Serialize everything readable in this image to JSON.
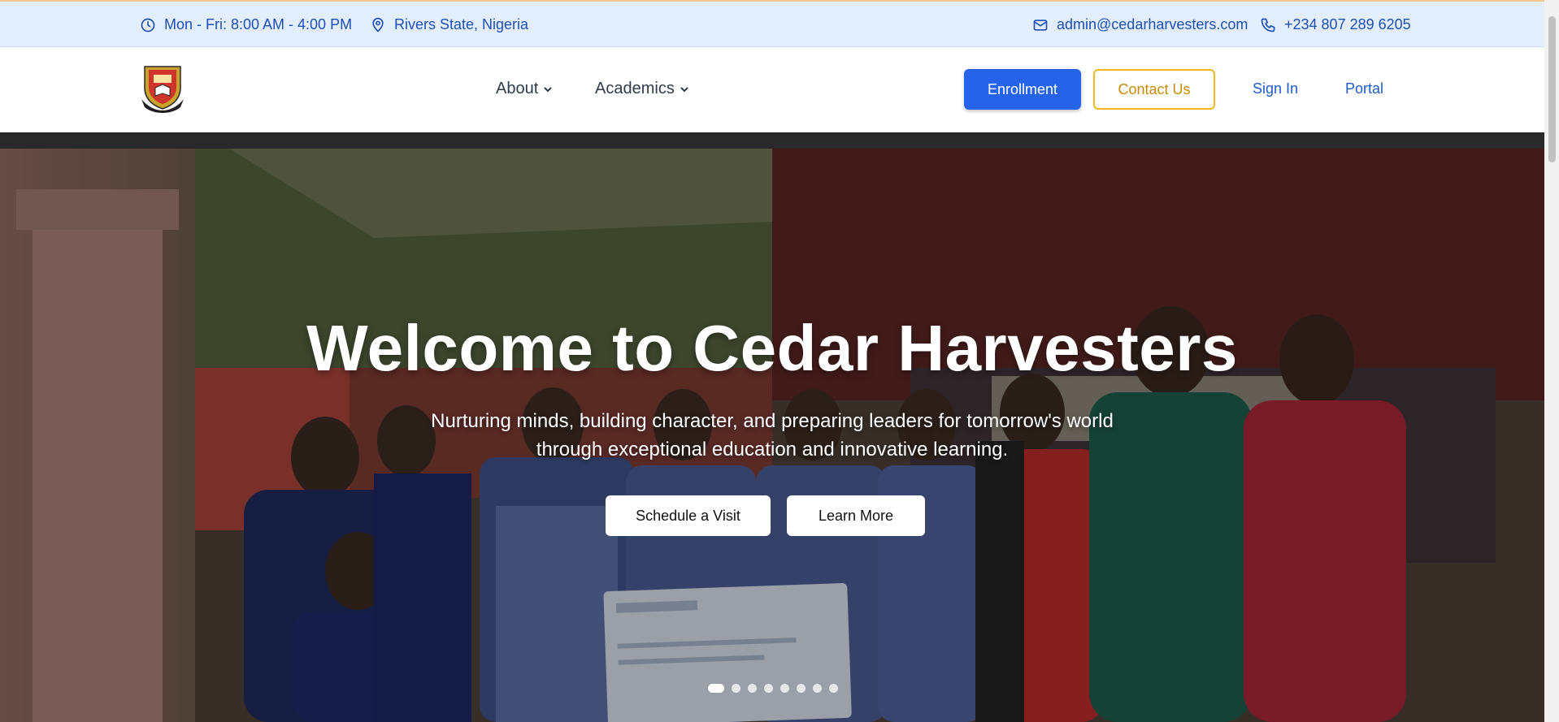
{
  "topbar": {
    "hours": "Mon - Fri: 8:00 AM - 4:00 PM",
    "location": "Rivers State, Nigeria",
    "email": "admin@cedarharvesters.com",
    "phone": "+234 807 289 6205"
  },
  "nav": {
    "about": "About",
    "academics": "Academics",
    "enrollment": "Enrollment",
    "contact": "Contact Us",
    "signin": "Sign In",
    "portal": "Portal"
  },
  "hero": {
    "title": "Welcome to Cedar Harvesters",
    "subtitle": "Nurturing minds, building character, and preparing leaders for tomorrow's world through exceptional education and innovative learning.",
    "schedule_button": "Schedule a Visit",
    "learn_button": "Learn More",
    "slide_count": 8,
    "active_slide": 1
  },
  "colors": {
    "accent": "#2563eb",
    "contact_border": "#f1b821",
    "topbar_bg": "#e3eefc",
    "link": "#1e5dc9"
  },
  "icons": {
    "hours": "clock-icon",
    "location": "map-pin-icon",
    "email": "mail-icon",
    "phone": "phone-icon",
    "dropdown": "chevron-down-icon",
    "logo": "school-crest-logo"
  }
}
